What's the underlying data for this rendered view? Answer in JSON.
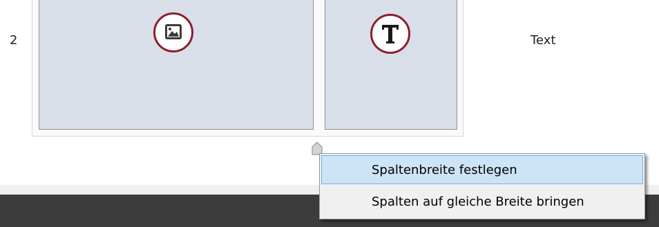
{
  "layout": {
    "row_number": "2",
    "columns": [
      {
        "content_type": "image",
        "icon": "image-icon"
      },
      {
        "content_type": "text",
        "icon": "text-T-icon"
      }
    ],
    "text_label": "Text"
  },
  "context_menu": {
    "items": [
      {
        "label": "Spaltenbreite festlegen",
        "highlighted": true
      },
      {
        "label": "Spalten auf gleiche Breite bringen",
        "highlighted": false
      }
    ]
  },
  "colors": {
    "cell_fill": "#d8dfe8",
    "cell_border": "#8f9399",
    "icon_ring": "#8b1e2b",
    "menu_highlight": "#cce4f7",
    "menu_highlight_border": "#78aee5",
    "dark_bar": "#3c3c3c"
  }
}
